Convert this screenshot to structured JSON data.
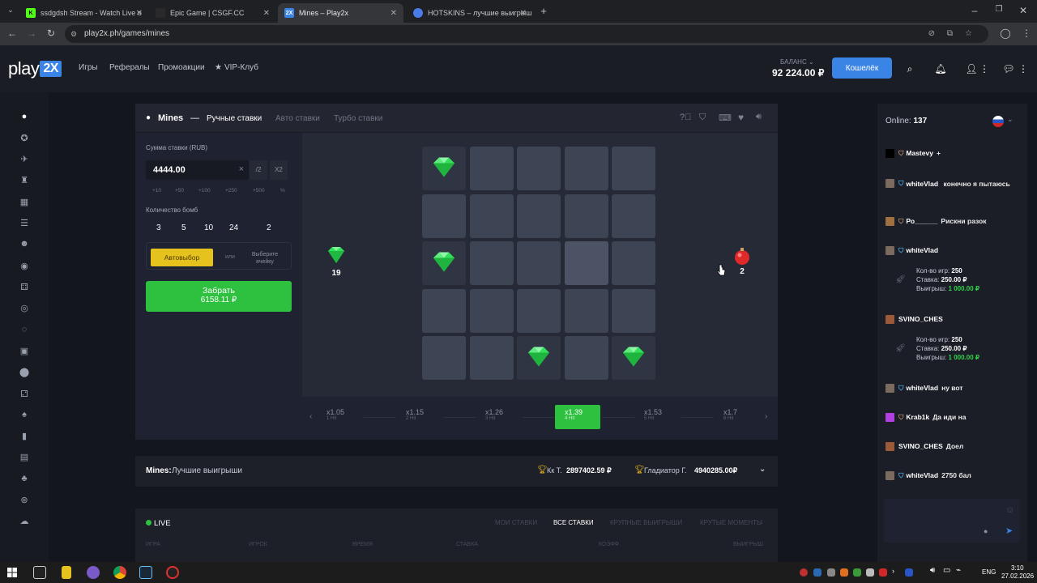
{
  "browser": {
    "tabs": [
      {
        "title": "ssdgdsh Stream - Watch Live o",
        "favicon": "kick-icon",
        "color": "#53fc18"
      },
      {
        "title": "Epic Game | CSGF.CC",
        "favicon": "csgf-icon",
        "color": "#2a2a2a"
      },
      {
        "title": "Mines – Play2x",
        "favicon": "play2x-icon",
        "color": "#3a84e6"
      },
      {
        "title": "HOTSKINS – лучшие выигрыш",
        "favicon": "hotskins-icon",
        "color": "#4a7be8"
      }
    ],
    "url": "play2x.ph/games/mines"
  },
  "header": {
    "logo_text": "play",
    "logo_badge": "2X",
    "nav": [
      "Игры",
      "Рефералы",
      "Промоакции",
      "VIP-Клуб"
    ],
    "balance_label": "БАЛАНС",
    "balance_value": "92 224.00 ₽",
    "wallet_button": "Кошелёк"
  },
  "game": {
    "title": "Mines",
    "separator": "—",
    "tabs": [
      "Ручные ставки",
      "Авто ставки",
      "Турбо ставки"
    ],
    "bet_label": "Сумма ставки (RUB)",
    "bet_value": "4444.00",
    "bet_clear": "×",
    "bet_half": "/2",
    "bet_double": "X2",
    "quick_bets": [
      "+10",
      "+50",
      "+100",
      "+250",
      "+500",
      "%"
    ],
    "bombs_label": "Количество бомб",
    "bomb_options": [
      "3",
      "5",
      "10",
      "24",
      "2"
    ],
    "autopick_button": "Автовыбор",
    "or_label": "или",
    "pick_cell_label": "Выберите ячейку",
    "cashout_label": "Забрать",
    "cashout_value": "6158.11 ₽",
    "gems_left": "19",
    "bombs_count": "2",
    "board": [
      [
        "gem",
        "",
        "",
        "",
        ""
      ],
      [
        "",
        "",
        "",
        "",
        ""
      ],
      [
        "gem",
        "",
        "",
        "hover",
        ""
      ],
      [
        "",
        "",
        "",
        "",
        ""
      ],
      [
        "",
        "",
        "gem",
        "",
        "gem"
      ]
    ],
    "multipliers": [
      {
        "value": "x1.05",
        "hits": "1 Hit"
      },
      {
        "value": "x1.15",
        "hits": "2 Hit"
      },
      {
        "value": "x1.26",
        "hits": "3 Hit"
      },
      {
        "value": "x1.39",
        "hits": "4 Hit",
        "active": true
      },
      {
        "value": "x1.53",
        "hits": "5 Hit"
      },
      {
        "value": "x1.7",
        "hits": "6 Hit"
      }
    ]
  },
  "best_wins": {
    "title": "Mines:",
    "subtitle": "Лучшие выигрыши",
    "winners": [
      {
        "name": "Кк Т.",
        "amount": "2897402.59 ₽"
      },
      {
        "name": "Гладиатор Г.",
        "amount": "4940285.00₽"
      }
    ]
  },
  "live": {
    "label": "LIVE",
    "tabs": [
      "МОИ СТАВКИ",
      "ВСЕ СТАВКИ",
      "КРУПНЫЕ ВЫИГРЫШИ",
      "КРУТЫЕ МОМЕНТЫ"
    ],
    "columns": [
      "ИГРА",
      "ИГРОК",
      "ВРЕМЯ",
      "СТАВКА",
      "КОЭФФ.",
      "ВЫИГРЫШ"
    ]
  },
  "chat": {
    "online_label": "Online:",
    "online_count": "137",
    "messages": [
      {
        "user": "Mastevy",
        "text": "+"
      },
      {
        "user": "whiteVlad",
        "text": "конечно я пытаюсь"
      },
      {
        "user": "Ро______",
        "text": "Рискни разок"
      },
      {
        "user": "whiteVlad",
        "text": ""
      },
      {
        "user": "SVINO_CHES",
        "text": ""
      },
      {
        "user": "whiteVlad",
        "text": "ну вот"
      },
      {
        "user": "Krab1k",
        "text": "Да иди на"
      },
      {
        "user": "SVINO_CHES",
        "text": "Доел"
      },
      {
        "user": "whiteVlad",
        "text": "2750 бал"
      }
    ],
    "stats": [
      {
        "games_label": "Кол-во игр:",
        "games": "250",
        "bet_label": "Ставка:",
        "bet": "250.00 ₽",
        "win_label": "Выигрыш:",
        "win": "1 000.00 ₽"
      },
      {
        "games_label": "Кол-во игр:",
        "games": "250",
        "bet_label": "Ставка:",
        "bet": "250.00 ₽",
        "win_label": "Выигрыш:",
        "win": "1 000.00 ₽"
      }
    ]
  },
  "taskbar": {
    "lang": "ENG",
    "time": "3:10",
    "date": "27.02.2026"
  }
}
